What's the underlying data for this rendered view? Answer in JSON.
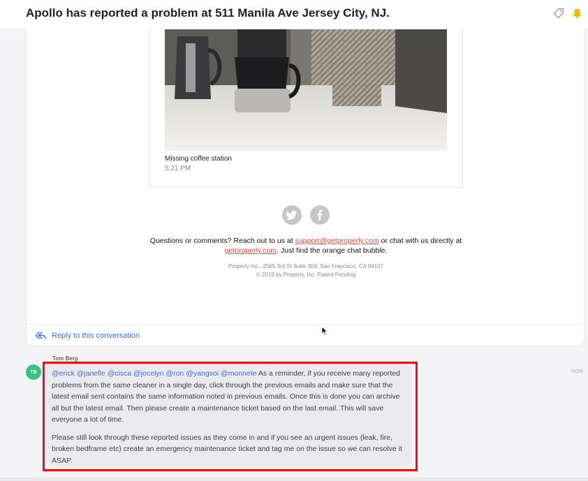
{
  "header": {
    "title": "Apollo has reported a problem at 511 Manila Ave Jersey City, NJ."
  },
  "email": {
    "caption": "Missing coffee station",
    "caption_time": "5:21 PM",
    "social": [
      "twitter-icon",
      "facebook-icon"
    ],
    "questions_prefix": "Questions or comments? Reach out to us at ",
    "support_email": "support@getproperly.com",
    "questions_middle": " or chat with us directly at ",
    "site_link": "getproperly.com",
    "questions_suffix": ". Just find the orange chat bubble.",
    "address_line": "Properly Inc., 2565 3rd St Suite 304, San Francisco, CA 94107",
    "copyright_line": "© 2019 by Properly, Inc. Patent Pending"
  },
  "reply": {
    "label": "Reply to this conversation"
  },
  "comment": {
    "author": "Tom Berg",
    "initials": "TB",
    "time": "NOW",
    "mentions": "@erick @janelle @cisca @jocelyn @ron @yangsoi @monnete",
    "paragraph1": " As a reminder, if you receive many reported problems from the same cleaner in a single day, click through the previous emails and make sure that the latest email sent contains the same information noted in previous emails. Once this is done you can archive all but the latest email. Then please create a maintenance ticket based on the last email. This will save everyone a lot of time.",
    "paragraph2": "Please still look through these reported issues as they come in and if you see an urgent issues (leak, fire, broken bedframe etc) create an emergency maintenance ticket and tag me on the issue so we can resolve it ASAP."
  },
  "colors": {
    "accent": "#3a6fd8",
    "link": "#e8452c",
    "highlight": "#e1141b",
    "avatar": "#33c481"
  }
}
